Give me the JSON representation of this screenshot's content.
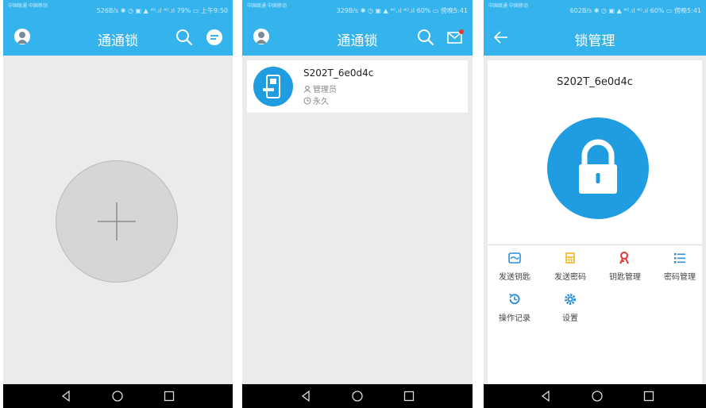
{
  "colors": {
    "accent": "#35b3ec",
    "lock_blue": "#1f9de0",
    "background": "#ebebeb",
    "badge_red": "#e53935"
  },
  "screens": [
    {
      "status": {
        "carrier": "中国联通 中国移动",
        "info": "526B/s ✱ ◷ ▣ ▲ ⁴ᴳ.ıl ⁴ᴳ.ıl 79% ▭ 上午9:50"
      },
      "header": {
        "title": "通通锁",
        "icons": [
          "avatar-icon",
          "search-icon",
          "message-icon"
        ]
      },
      "main": {
        "add_icon": "plus-icon"
      }
    },
    {
      "status": {
        "carrier": "中国联通 中国移动",
        "info": "329B/s ✱ ◷ ▣ ▲ ⁴ᴳ.ıl ⁴ᴳ.ıl 60% ▭ 傍晚5:41"
      },
      "header": {
        "title": "通通锁",
        "icons": [
          "avatar-icon",
          "search-icon",
          "mail-icon"
        ]
      },
      "lock_item": {
        "name": "S202T_6e0d4c",
        "role": "管理员",
        "validity": "永久"
      }
    },
    {
      "status": {
        "carrier": "中国联通 中国移动",
        "info": "602B/s ✱ ◷ ▣ ▲ ⁴ᴳ.ıl ⁴ᴳ.ıl 60% ▭ 傍晚5:41"
      },
      "header": {
        "title": "锁管理",
        "icons": [
          "back-arrow-icon"
        ]
      },
      "lock_name": "S202T_6e0d4c",
      "actions": [
        {
          "label": "发送钥匙",
          "icon": "send-key-icon"
        },
        {
          "label": "发送密码",
          "icon": "send-password-icon"
        },
        {
          "label": "钥匙管理",
          "icon": "key-management-icon"
        },
        {
          "label": "密码管理",
          "icon": "password-management-icon"
        },
        {
          "label": "操作记录",
          "icon": "history-icon"
        },
        {
          "label": "设置",
          "icon": "settings-icon"
        }
      ]
    }
  ],
  "nav_buttons": [
    "back-icon",
    "home-icon",
    "recent-apps-icon"
  ]
}
